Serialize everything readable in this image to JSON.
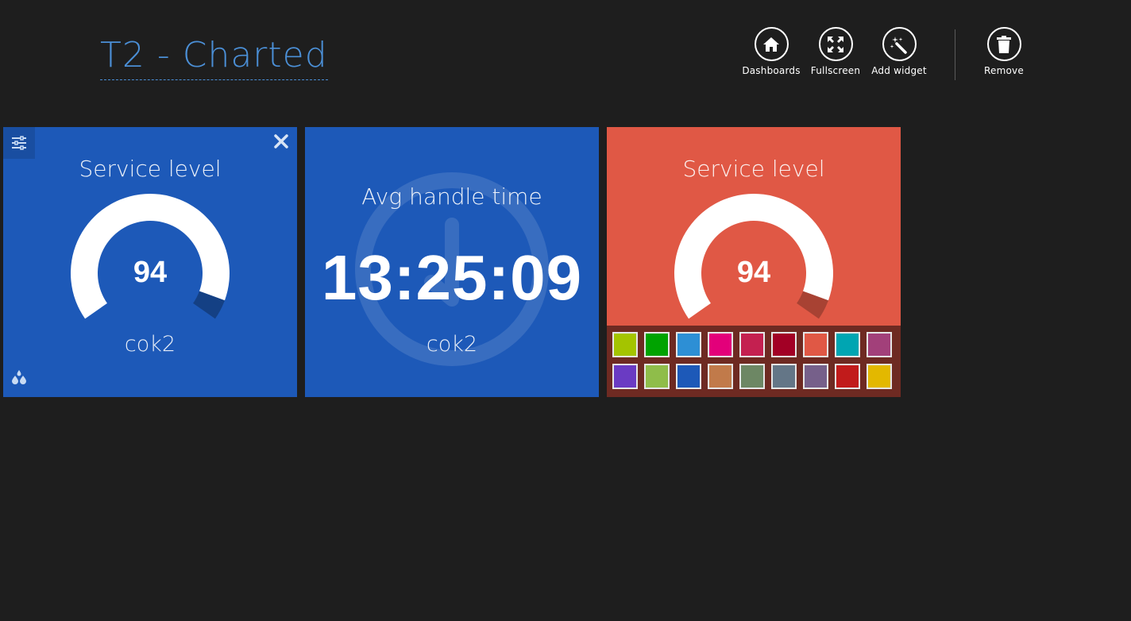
{
  "app": {
    "title": "T2 - Charted"
  },
  "toolbar": {
    "dashboards": {
      "label": "Dashboards",
      "icon": "home-icon"
    },
    "fullscreen": {
      "label": "Fullscreen",
      "icon": "fullscreen-icon"
    },
    "add_widget": {
      "label": "Add widget",
      "icon": "magic-wand-icon"
    },
    "remove": {
      "label": "Remove",
      "icon": "trash-icon"
    }
  },
  "widgets": [
    {
      "title": "Service level",
      "value": "94",
      "subtitle": "cok2",
      "gauge_fraction": 0.94,
      "color": "#1d59b8",
      "icons": [
        "settings-icon",
        "close-icon",
        "color-drops-icon"
      ]
    },
    {
      "title": "Avg handle time",
      "value": "13:25:09",
      "subtitle": "cok2",
      "color": "#1d59b8",
      "icons": [
        "clock-icon"
      ]
    },
    {
      "title": "Service level",
      "value": "94",
      "subtitle": "cok2",
      "gauge_fraction": 0.94,
      "color": "#e05845"
    }
  ],
  "palette": {
    "colors": [
      "#a4c400",
      "#00a300",
      "#2d8fd5",
      "#e3007a",
      "#c42050",
      "#a20025",
      "#e05845",
      "#00a5b2",
      "#a2407a",
      "#6a3bc3",
      "#8fbd4a",
      "#1d59b8",
      "#c17a4a",
      "#6d8764",
      "#647687",
      "#76608a",
      "#c11b1b",
      "#e3b800"
    ]
  }
}
